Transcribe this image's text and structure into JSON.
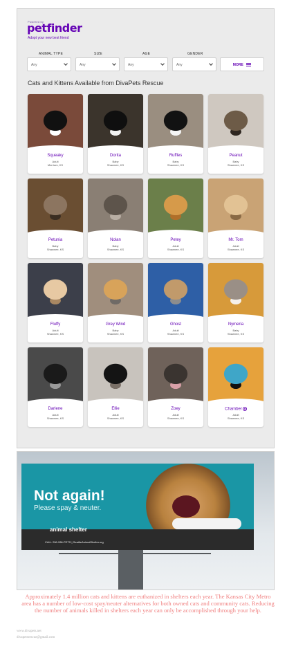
{
  "brand": {
    "powered_by": "Powered by",
    "logo": "petfinder",
    "tagline": "Adopt your new best friend"
  },
  "filters": [
    {
      "label": "ANIMAL TYPE",
      "value": "Any"
    },
    {
      "label": "SIZE",
      "value": "Any"
    },
    {
      "label": "AGE",
      "value": "Any"
    },
    {
      "label": "GENDER",
      "value": "Any"
    }
  ],
  "more_label": "MORE",
  "section_title": "Cats and Kittens Available from DivaPets Rescue",
  "pets": [
    {
      "name": "Squeaky",
      "age": "Adult",
      "location": "Merriam, KS",
      "colors": [
        "#7a4a3a",
        "#111111",
        "#ffffff"
      ]
    },
    {
      "name": "Dorita",
      "age": "Baby",
      "location": "Shawnee, KS",
      "colors": [
        "#3b342c",
        "#0f0f0f",
        "#f2f2f2"
      ]
    },
    {
      "name": "Ruffles",
      "age": "Baby",
      "location": "Shawnee, KS",
      "colors": [
        "#9a8e80",
        "#121212",
        "#f5f5f5"
      ]
    },
    {
      "name": "Peanut",
      "age": "Baby",
      "location": "Shawnee, KS",
      "colors": [
        "#cfc8c0",
        "#6d5b47",
        "#2e2620"
      ]
    },
    {
      "name": "Petunia",
      "age": "Baby",
      "location": "Shawnee, KS",
      "colors": [
        "#6a4e32",
        "#8c7560",
        "#3b2e22"
      ]
    },
    {
      "name": "Nolan",
      "age": "Baby",
      "location": "Shawnee, KS",
      "colors": [
        "#8a7f74",
        "#5d544b",
        "#b8aea3"
      ]
    },
    {
      "name": "Petey",
      "age": "Adult",
      "location": "Shawnee, KS",
      "colors": [
        "#6b7f4a",
        "#d69a4a",
        "#b06f2a"
      ]
    },
    {
      "name": "Mr. Tom",
      "age": "Adult",
      "location": "Shawnee, KS",
      "colors": [
        "#c9a375",
        "#e2c294",
        "#8a6a45"
      ]
    },
    {
      "name": "Fluffy",
      "age": "Adult",
      "location": "Shawnee, KS",
      "colors": [
        "#3c3f4a",
        "#e7c9a3",
        "#a88762"
      ]
    },
    {
      "name": "Grey Wind",
      "age": "Baby",
      "location": "Shawnee, KS",
      "colors": [
        "#a08e7d",
        "#d8a35a",
        "#6f6a66"
      ]
    },
    {
      "name": "Ghost",
      "age": "Adult",
      "location": "Shawnee, KS",
      "colors": [
        "#2e5fa6",
        "#c19a6b",
        "#8d8d8d"
      ]
    },
    {
      "name": "Nymeria",
      "age": "Baby",
      "location": "Shawnee, KS",
      "colors": [
        "#d79a3a",
        "#9a8f86",
        "#f5f0ea"
      ]
    },
    {
      "name": "Darlene",
      "age": "Adult",
      "location": "Shawnee, KS",
      "colors": [
        "#4a4a4a",
        "#1a1a1a",
        "#9a9a9a"
      ]
    },
    {
      "name": "Ellie",
      "age": "Adult",
      "location": "Shawnee, KS",
      "colors": [
        "#c8c3bd",
        "#141414",
        "#7a7067"
      ]
    },
    {
      "name": "Zoey",
      "age": "Adult",
      "location": "Shawnee, KS",
      "colors": [
        "#6f625a",
        "#3a3430",
        "#d9a0a8"
      ]
    },
    {
      "name": "Chamber",
      "age": "Adult",
      "location": "Shawnee, KS",
      "colors": [
        "#e6a23c",
        "#3fa6c8",
        "#111111"
      ]
    }
  ],
  "billboard": {
    "headline": "Not again!",
    "subline": "Please spay & neuter.",
    "org": "animal shelter",
    "phone": "CALL 206-286-PETS  |  SeattleAnimalShelter.org"
  },
  "blurb": "Approximately 1.4 million cats and kittens are euthanized in shelters each year. The Kansas City Metro area has a number of low-cost spay/neuter alternatives for both owned cats and community cats. Reducing the number of animals killed in shelters each year can only be accomplished through your help.",
  "footer": {
    "website": "www.divapets.net",
    "email": "divapetsrescue@gmail.com"
  },
  "colors": {
    "accent": "#6504b5",
    "blurb": "#f08080"
  }
}
